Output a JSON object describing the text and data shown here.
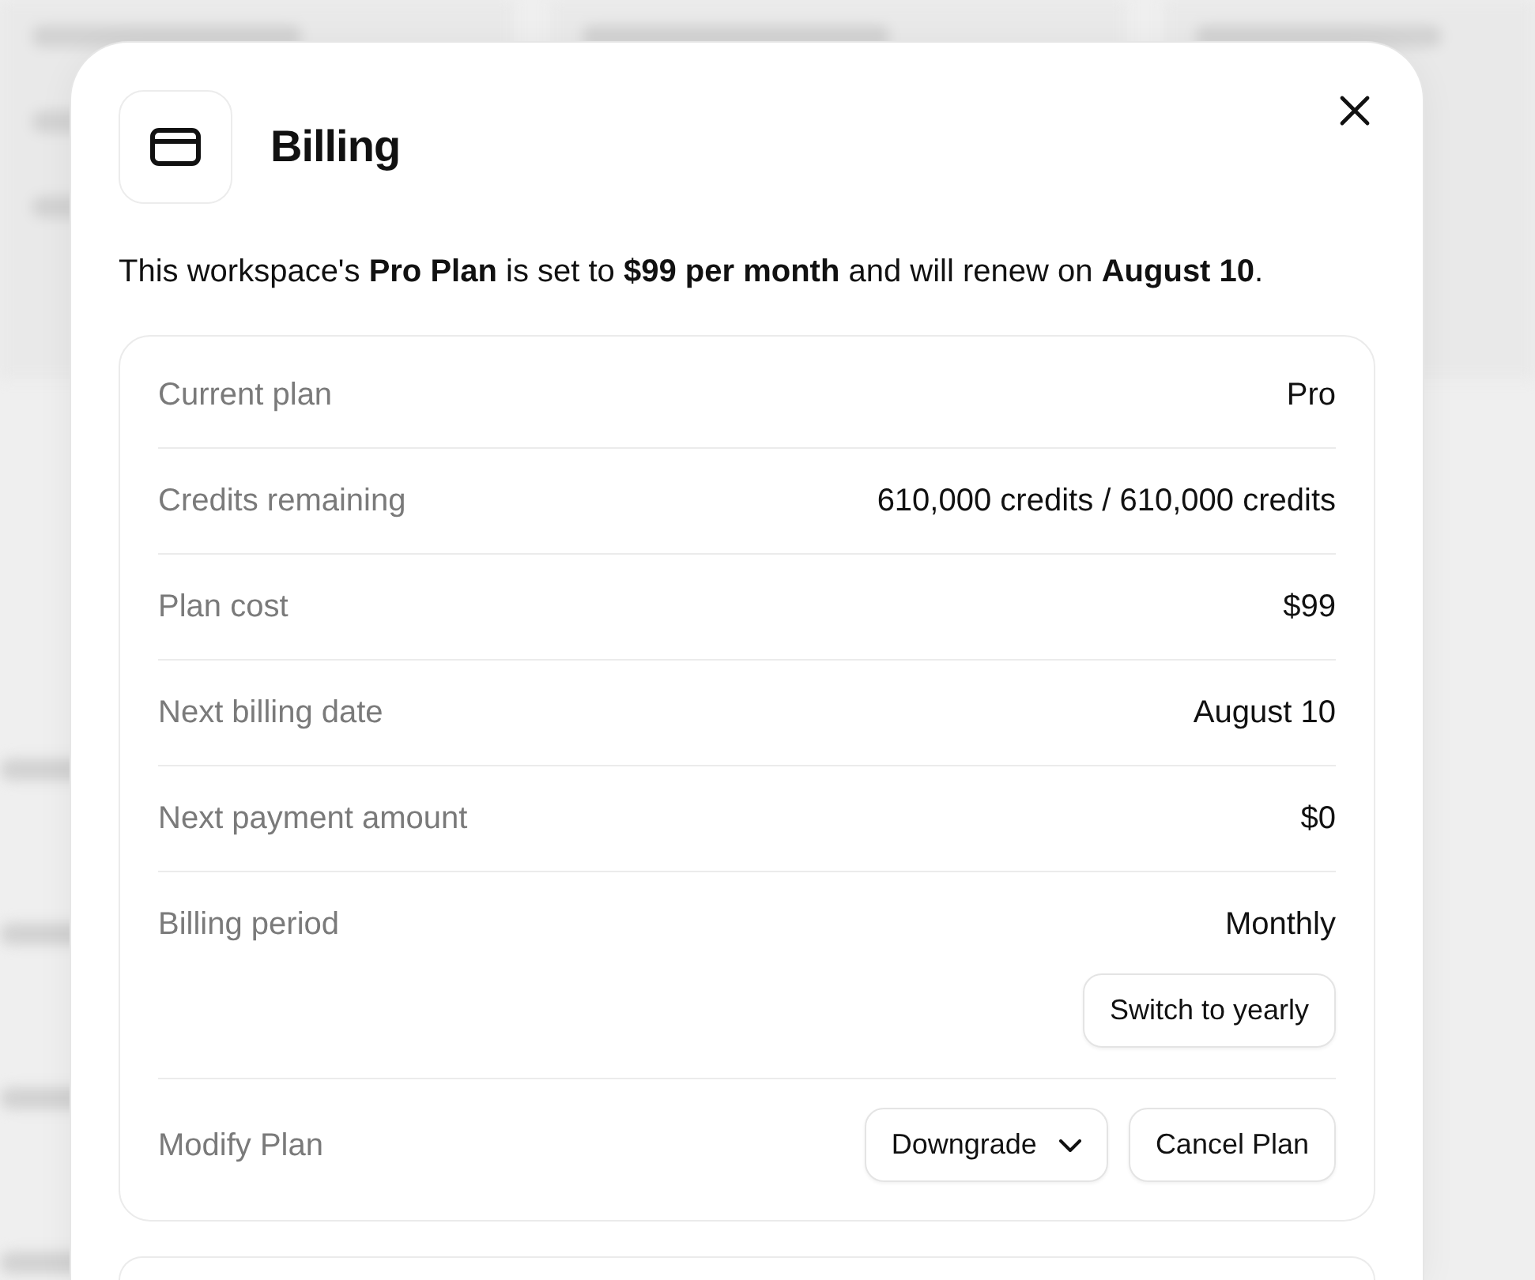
{
  "dialog": {
    "title": "Billing",
    "summary": "This workspace's **Pro Plan** is set to **$99 per month** and will renew on **August 10**.",
    "details": [
      {
        "kind": "text",
        "label": "Current plan",
        "value": "Pro"
      },
      {
        "kind": "text",
        "label": "Credits remaining",
        "value": "610,000 credits / 610,000 credits"
      },
      {
        "kind": "text",
        "label": "Plan cost",
        "value": "$99"
      },
      {
        "kind": "text",
        "label": "Next billing date",
        "value": "August 10"
      },
      {
        "kind": "text",
        "label": "Next payment amount",
        "value": "$0"
      },
      {
        "kind": "text_with_button",
        "label": "Billing period",
        "value": "Monthly",
        "button": "Switch to yearly"
      },
      {
        "kind": "buttons",
        "label": "Modify Plan",
        "buttons": [
          {
            "kind": "menu",
            "label": "Downgrade"
          },
          {
            "kind": "plain",
            "label": "Cancel Plan"
          }
        ]
      }
    ]
  }
}
